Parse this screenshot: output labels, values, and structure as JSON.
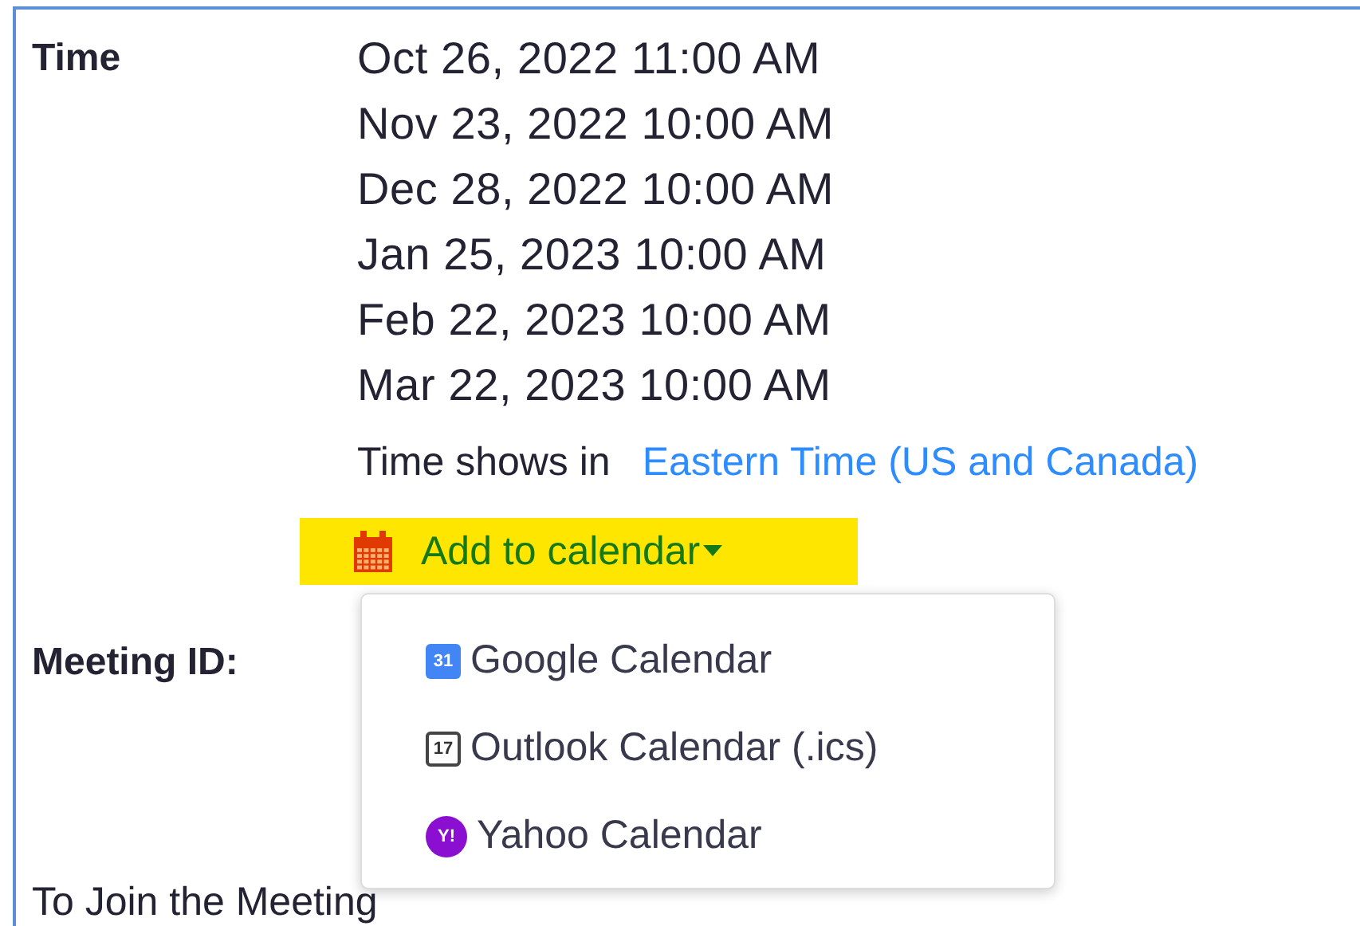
{
  "time": {
    "label": "Time",
    "dates": [
      "Oct 26, 2022 11:00 AM",
      "Nov 23, 2022 10:00 AM",
      "Dec 28, 2022 10:00 AM",
      "Jan 25, 2023 10:00 AM",
      "Feb 22, 2023 10:00 AM",
      "Mar 22, 2023 10:00 AM"
    ],
    "zone_prefix": "Time shows in",
    "zone_link": "Eastern Time (US and Canada)"
  },
  "add_to_calendar": {
    "label": "Add to calendar",
    "expanded": true,
    "options": [
      {
        "kind": "google",
        "icon_text": "31",
        "label": "Google Calendar"
      },
      {
        "kind": "outlook",
        "icon_text": "17",
        "label": "Outlook Calendar (.ics)"
      },
      {
        "kind": "yahoo",
        "icon_text": "Y!",
        "label": "Yahoo Calendar"
      }
    ]
  },
  "meeting_id": {
    "label": "Meeting ID:"
  },
  "join_heading": "To Join the Meeting"
}
